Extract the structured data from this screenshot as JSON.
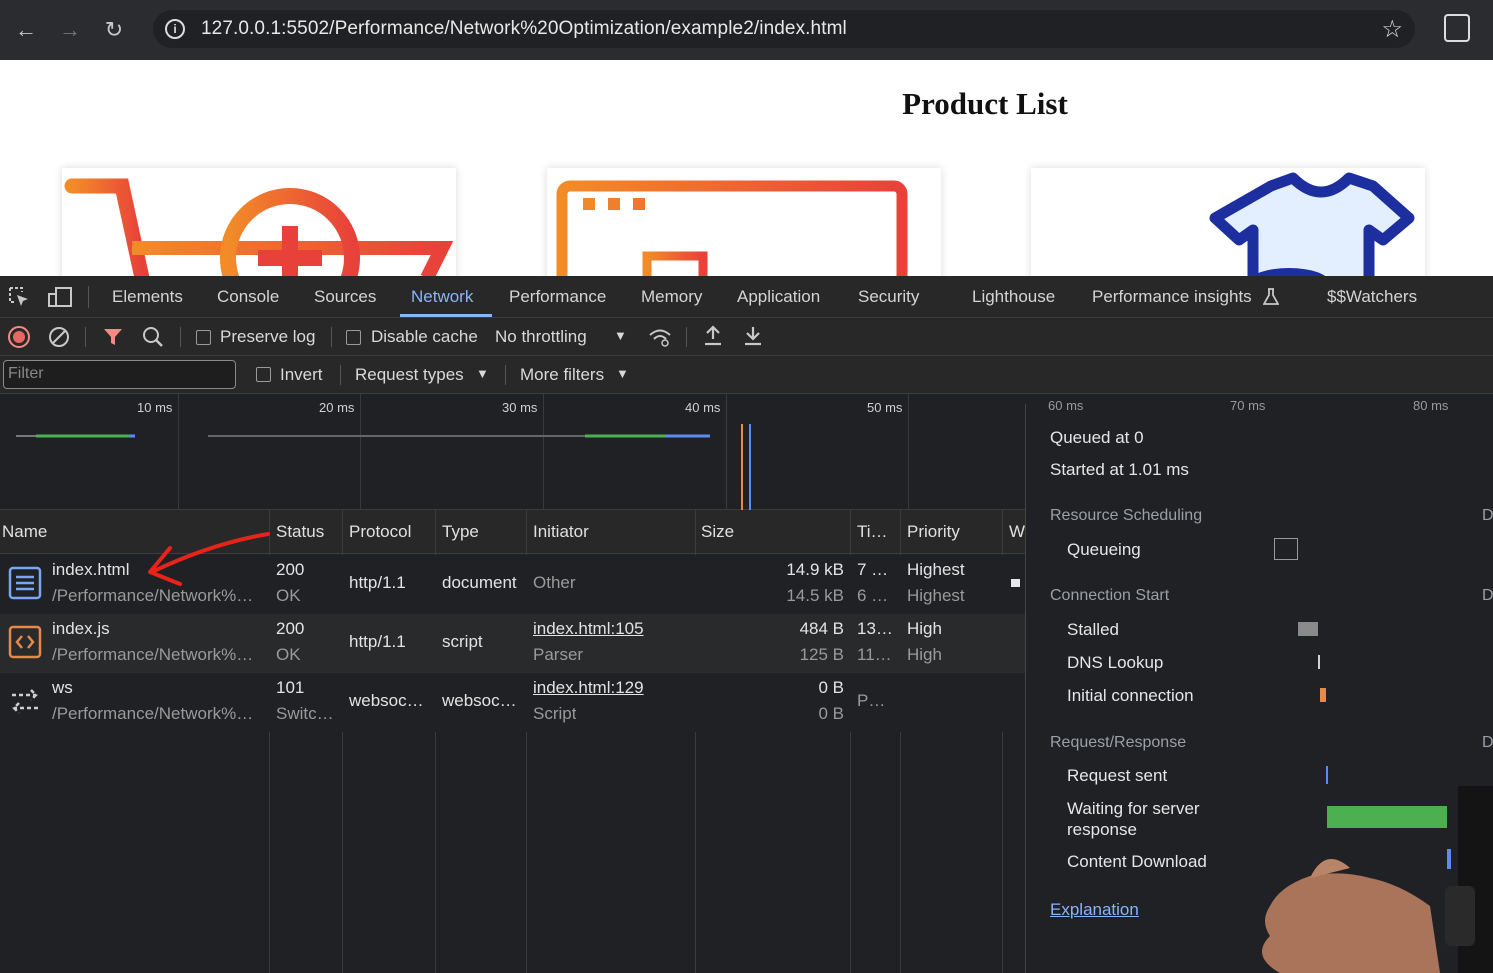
{
  "browser": {
    "url": "127.0.0.1:5502/Performance/Network%20Optimization/example2/index.html",
    "back_icon": "←",
    "forward_icon": "→",
    "reload_icon": "↻",
    "bookmark_icon": "☆",
    "info_icon": "i"
  },
  "page": {
    "title": "Product List"
  },
  "devtools": {
    "tabs": [
      "Elements",
      "Console",
      "Sources",
      "Network",
      "Performance",
      "Memory",
      "Application",
      "Security",
      "Lighthouse",
      "Performance insights",
      "$$Watchers"
    ],
    "active_tab": "Network",
    "toolbar": {
      "preserve_log": "Preserve log",
      "disable_cache": "Disable cache",
      "throttling": "No throttling"
    },
    "filterbar": {
      "filter_placeholder": "Filter",
      "invert": "Invert",
      "request_types": "Request types",
      "more_filters": "More filters"
    },
    "overview_ticks": [
      "10 ms",
      "20 ms",
      "30 ms",
      "40 ms",
      "50 ms",
      "60 ms",
      "70 ms",
      "80 ms"
    ],
    "columns": [
      "Name",
      "Status",
      "Protocol",
      "Type",
      "Initiator",
      "Size",
      "Ti…",
      "Priority",
      "W"
    ],
    "rows": [
      {
        "name": "index.html",
        "path": "/Performance/Network%…",
        "status": "200",
        "status_text": "OK",
        "protocol": "http/1.1",
        "type": "document",
        "initiator": "Other",
        "initiator_sub": "",
        "size": "14.9 kB",
        "size_sub": "14.5 kB",
        "time": "7 …",
        "time_sub": "6 …",
        "priority": "Highest",
        "priority_sub": "Highest"
      },
      {
        "name": "index.js",
        "path": "/Performance/Network%…",
        "status": "200",
        "status_text": "OK",
        "protocol": "http/1.1",
        "type": "script",
        "initiator": "index.html:105",
        "initiator_sub": "Parser",
        "size": "484 B",
        "size_sub": "125 B",
        "time": "13…",
        "time_sub": "11…",
        "priority": "High",
        "priority_sub": "High"
      },
      {
        "name": "ws",
        "path": "/Performance/Network%…",
        "status": "101",
        "status_text": "Switc…",
        "protocol": "websoc…",
        "type": "websoc…",
        "initiator": "index.html:129",
        "initiator_sub": "Script",
        "size": "0 B",
        "size_sub": "0 B",
        "time": "P…",
        "time_sub": "",
        "priority": "",
        "priority_sub": ""
      }
    ],
    "timing": {
      "queued": "Queued at 0",
      "started": "Started at 1.01 ms",
      "section_scheduling": "Resource Scheduling",
      "queueing": "Queueing",
      "section_connection": "Connection Start",
      "stalled": "Stalled",
      "dns": "DNS Lookup",
      "initial": "Initial connection",
      "section_request": "Request/Response",
      "request_sent": "Request sent",
      "waiting_line1": "Waiting for server",
      "waiting_line2": "response",
      "content_download": "Content Download",
      "explanation": "Explanation",
      "col_d": "D"
    },
    "colors": {
      "accent": "#8ab4f8",
      "green": "#4caf50",
      "annotation_arrow": "#e8231a"
    }
  }
}
